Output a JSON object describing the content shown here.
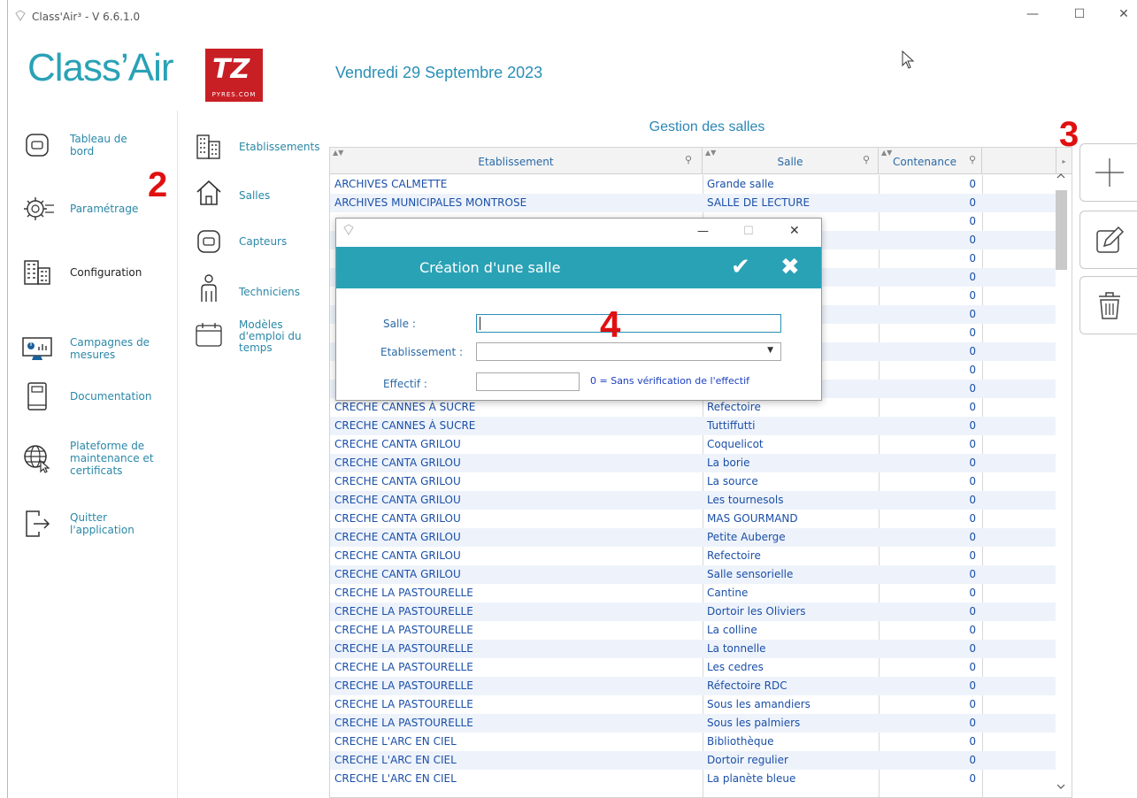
{
  "window": {
    "title": "Class'Air³ - V 6.6.1.0",
    "minimize": "—",
    "maximize": "☐",
    "close": "✕"
  },
  "app": {
    "logo": "Class’Air",
    "brand_logo": "TZ",
    "brand_sub": "PYRES.COM",
    "date": "Vendredi 29 Septembre 2023"
  },
  "nav": {
    "items": [
      {
        "label": "Tableau de bord",
        "icon": "sensor-icon"
      },
      {
        "label": "Paramétrage",
        "icon": "gears-icon"
      },
      {
        "label": "Configuration",
        "icon": "building-icon"
      },
      {
        "label": "Campagnes de mesures",
        "icon": "monitor-chart-icon"
      },
      {
        "label": "Documentation",
        "icon": "book-icon"
      },
      {
        "label": "Plateforme de maintenance et certificats",
        "icon": "globe-cursor-icon"
      },
      {
        "label": "Quitter l'application",
        "icon": "exit-icon"
      }
    ]
  },
  "subnav": {
    "items": [
      {
        "label": "Etablissements",
        "icon": "building-icon"
      },
      {
        "label": "Salles",
        "icon": "house-icon"
      },
      {
        "label": "Capteurs",
        "icon": "sensor-icon"
      },
      {
        "label": "Techniciens",
        "icon": "person-icon"
      },
      {
        "label": "Modèles d'emploi du temps",
        "icon": "calendar-icon"
      }
    ]
  },
  "annotations": {
    "a2": "2",
    "a3": "3",
    "a4": "4"
  },
  "grid": {
    "title": "Gestion des salles",
    "columns": [
      "Etablissement",
      "Salle",
      "Contenance"
    ],
    "rows": [
      [
        "ARCHIVES CALMETTE",
        "Grande salle",
        "0"
      ],
      [
        "ARCHIVES MUNICIPALES MONTROSE",
        "SALLE DE LECTURE",
        "0"
      ],
      [
        "",
        "",
        "0"
      ],
      [
        "",
        "",
        "0"
      ],
      [
        "",
        "",
        "0"
      ],
      [
        "",
        "",
        "0"
      ],
      [
        "",
        "",
        "0"
      ],
      [
        "",
        "",
        "0"
      ],
      [
        "",
        "",
        "0"
      ],
      [
        "",
        "",
        "0"
      ],
      [
        "",
        "",
        "0"
      ],
      [
        "",
        "",
        "0"
      ],
      [
        "CRECHE CANNES À SUCRE",
        "Refectoire",
        "0"
      ],
      [
        "CRECHE CANNES À SUCRE",
        "Tuttiffutti",
        "0"
      ],
      [
        "CRECHE CANTA GRILOU",
        "Coquelicot",
        "0"
      ],
      [
        "CRECHE CANTA GRILOU",
        "La borie",
        "0"
      ],
      [
        "CRECHE CANTA GRILOU",
        "La source",
        "0"
      ],
      [
        "CRECHE CANTA GRILOU",
        "Les tournesols",
        "0"
      ],
      [
        "CRECHE CANTA GRILOU",
        "MAS GOURMAND",
        "0"
      ],
      [
        "CRECHE CANTA GRILOU",
        "Petite Auberge",
        "0"
      ],
      [
        "CRECHE CANTA GRILOU",
        "Refectoire",
        "0"
      ],
      [
        "CRECHE CANTA GRILOU",
        "Salle sensorielle",
        "0"
      ],
      [
        "CRECHE LA PASTOURELLE",
        "Cantine",
        "0"
      ],
      [
        "CRECHE LA PASTOURELLE",
        "Dortoir les Oliviers",
        "0"
      ],
      [
        "CRECHE LA PASTOURELLE",
        "La colline",
        "0"
      ],
      [
        "CRECHE LA PASTOURELLE",
        "La tonnelle",
        "0"
      ],
      [
        "CRECHE LA PASTOURELLE",
        "Les cedres",
        "0"
      ],
      [
        "CRECHE LA PASTOURELLE",
        "Réfectoire RDC",
        "0"
      ],
      [
        "CRECHE LA PASTOURELLE",
        "Sous les amandiers",
        "0"
      ],
      [
        "CRECHE LA PASTOURELLE",
        "Sous les palmiers",
        "0"
      ],
      [
        "CRECHE L'ARC EN CIEL",
        "Bibliothèque",
        "0"
      ],
      [
        "CRECHE L'ARC EN CIEL",
        "Dortoir regulier",
        "0"
      ],
      [
        "CRECHE L'ARC EN CIEL",
        "La planète bleue",
        "0"
      ]
    ]
  },
  "dialog": {
    "title": "Création d'une salle",
    "confirm": "✔",
    "cancel": "✖",
    "salle_label": "Salle :",
    "salle_value": "",
    "etab_label": "Etablissement :",
    "etab_value": "",
    "effectif_label": "Effectif :",
    "effectif_value": "",
    "hint": "0 = Sans vérification de l'effectif"
  },
  "colors": {
    "accent": "#2aa2b6",
    "link": "#2a88a8",
    "annotation": "#e01010",
    "brand": "#c81f25"
  }
}
